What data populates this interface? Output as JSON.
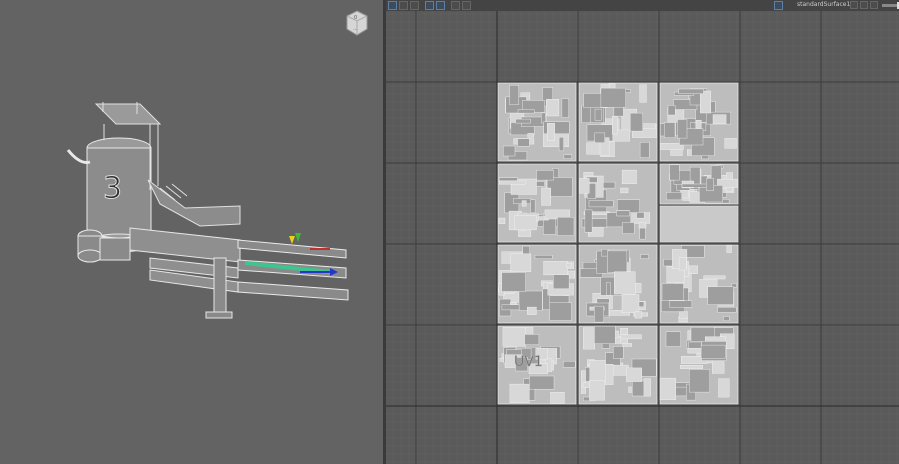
{
  "viewport": {
    "label": "3d-viewport",
    "viewcube": {
      "icon": "viewcube-icon"
    },
    "tank_number": "3"
  },
  "uv_editor": {
    "toolbar": {
      "buttons": [
        {
          "icon": "uv-select-icon"
        },
        {
          "icon": "uv-shell-icon"
        },
        {
          "icon": "uv-snap-icon"
        },
        {
          "icon": "uv-grid-toggle-icon"
        },
        {
          "icon": "uv-checker-icon"
        },
        {
          "icon": "uv-image-icon"
        },
        {
          "icon": "uv-camera-icon"
        }
      ],
      "shader_name": "standardSurface1",
      "right_icons": [
        "uv-texture-toggle-icon",
        "uv-exposure-icon",
        "uv-gamma-icon"
      ]
    },
    "uv_tile_label": "UV1"
  }
}
